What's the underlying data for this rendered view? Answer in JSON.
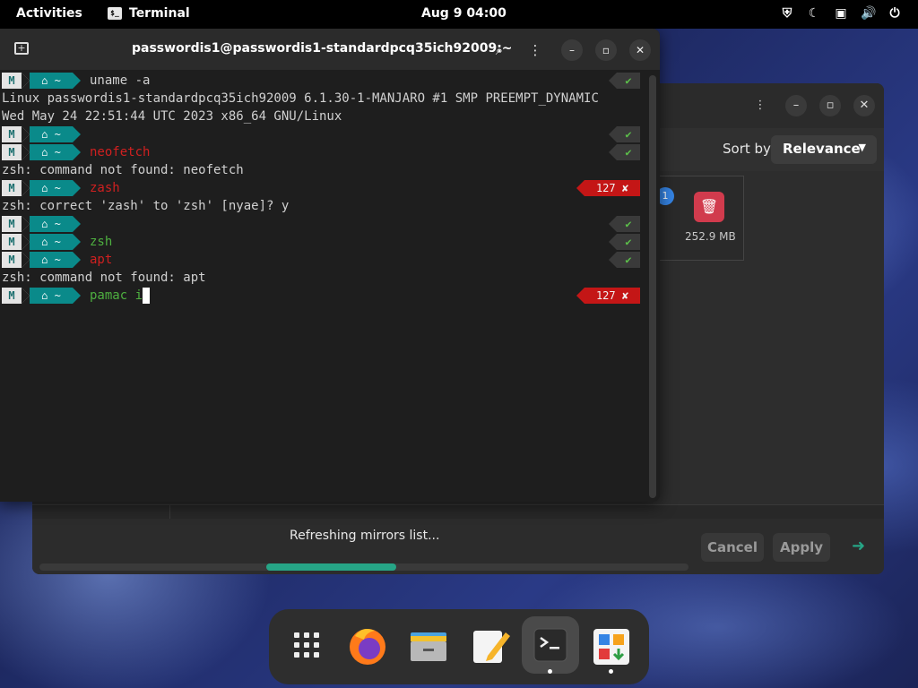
{
  "topbar": {
    "activities": "Activities",
    "app_name": "Terminal",
    "clock": "Aug 9  04:00",
    "tray_icons": [
      "shield-icon",
      "night-light-icon",
      "screen-share-icon",
      "volume-icon",
      "power-icon"
    ]
  },
  "terminal": {
    "title": "passwordis1@passwordis1-standardpcq35ich92009:~",
    "prompt_dir": "~",
    "lines": [
      {
        "kind": "prompt",
        "cmd": "uname -a",
        "cmd_color": "plain",
        "status": "ok"
      },
      {
        "kind": "output",
        "text": "Linux passwordis1-standardpcq35ich92009 6.1.30-1-MANJARO #1 SMP PREEMPT_DYNAMIC"
      },
      {
        "kind": "output",
        "text": "Wed May 24 22:51:44 UTC 2023 x86_64 GNU/Linux"
      },
      {
        "kind": "prompt",
        "cmd": "",
        "cmd_color": "plain",
        "status": "ok"
      },
      {
        "kind": "prompt",
        "cmd": "neofetch",
        "cmd_color": "bad",
        "status": "ok"
      },
      {
        "kind": "output",
        "text": "zsh: command not found: neofetch"
      },
      {
        "kind": "prompt",
        "cmd": "zash",
        "cmd_color": "bad",
        "status": "err",
        "code": "127 ✘"
      },
      {
        "kind": "output",
        "text": "zsh: correct 'zash' to 'zsh' [nyae]? y"
      },
      {
        "kind": "prompt",
        "cmd": "",
        "cmd_color": "plain",
        "status": "ok"
      },
      {
        "kind": "prompt",
        "cmd": "zsh",
        "cmd_color": "ok",
        "status": "ok"
      },
      {
        "kind": "prompt",
        "cmd": "apt",
        "cmd_color": "bad",
        "status": "ok"
      },
      {
        "kind": "output",
        "text": "zsh: command not found: apt"
      },
      {
        "kind": "prompt",
        "cmd": "pamac i",
        "cmd_color": "ok",
        "status": "err",
        "code": "127 ✘",
        "cursor": true
      }
    ],
    "ok_mark": "✔"
  },
  "software": {
    "sort_by_label": "Sort by",
    "sort_value": "Relevance",
    "badge": "1",
    "item_size": "252.9 MB",
    "status_text": "Refreshing mirrors list...",
    "cancel_label": "Cancel",
    "apply_label": "Apply",
    "progress": 0.2
  },
  "dock": {
    "items": [
      "app-grid-icon",
      "firefox-icon",
      "file-manager-icon",
      "text-editor-icon",
      "terminal-icon",
      "software-store-icon"
    ]
  }
}
